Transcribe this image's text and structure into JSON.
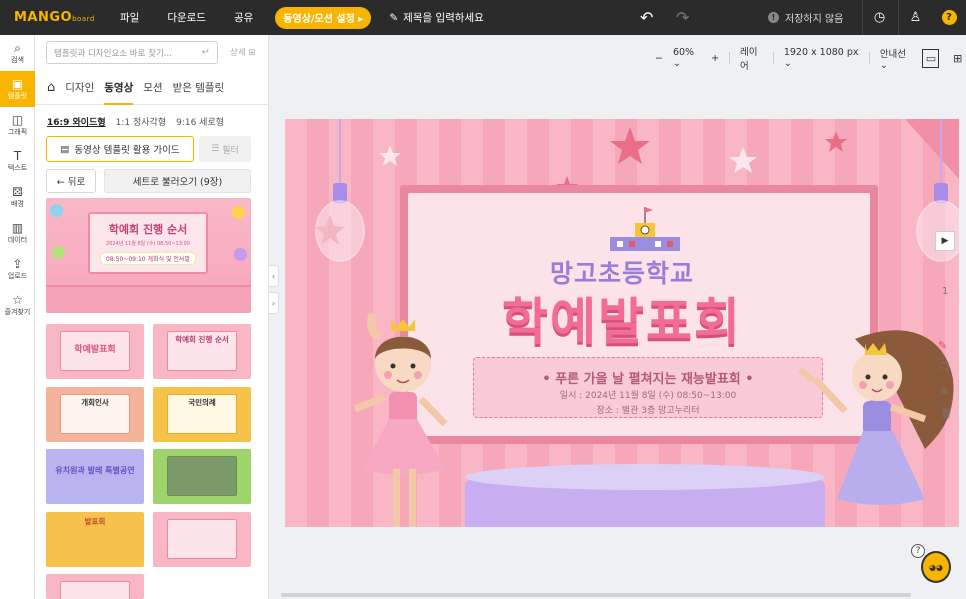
{
  "topbar": {
    "logo": "MANGO",
    "logo_sub": "board",
    "menu": [
      "파일",
      "다운로드",
      "공유"
    ],
    "mode_pill": "동영상/모션 설정 ▸",
    "title_placeholder": "제목을 입력하세요",
    "saved_status": "저장하지 않음",
    "help": "?"
  },
  "rail": [
    {
      "label": "검색",
      "icon": "⌕"
    },
    {
      "label": "템플릿",
      "icon": "▣"
    },
    {
      "label": "그래픽",
      "icon": "◫"
    },
    {
      "label": "텍스트",
      "icon": "T"
    },
    {
      "label": "배경",
      "icon": "⚄"
    },
    {
      "label": "데이터",
      "icon": "▥"
    },
    {
      "label": "업로드",
      "icon": "⇪"
    },
    {
      "label": "즐겨찾기",
      "icon": "☆"
    }
  ],
  "panel": {
    "search_placeholder": "템플릿과 디자인요소 바로 찾기...",
    "search_enter": "↵",
    "detail": "상세 ⊞",
    "tabs": [
      "디자인",
      "동영상",
      "모션",
      "받은 템플릿"
    ],
    "ratios": [
      "16:9 와이드형",
      "1:1 정사각형",
      "9:16 세로형"
    ],
    "guide_button": "동영상 템플릿 활용 가이드",
    "filter_button": "필터",
    "back_button": "← 뒤로",
    "set_button": "세트로 불러오기 (9장)",
    "big_thumb": {
      "title": "학예회 진행 순서",
      "sub": "2024년 11월 8일 (수) 08:50~13:00",
      "pill": "08:50~09:10 개회식 및 인사말"
    },
    "thumbs": [
      {
        "label": "학예발표회"
      },
      {
        "label": "학예회 진행 순서"
      },
      {
        "label": "개회인사"
      },
      {
        "label": "국민의례"
      },
      {
        "label": "유치원과 발레 특별공연"
      },
      {
        "label": ""
      },
      {
        "label": "발표회"
      },
      {
        "label": ""
      },
      {
        "label": ""
      }
    ]
  },
  "editor": {
    "zoom_minus": "−",
    "zoom": "60%",
    "zoom_plus": "+",
    "layer": "레이어",
    "size": "1920 x 1080 px",
    "guide": "안내선"
  },
  "canvas": {
    "school": "망고초등학교",
    "event": "학예발표회",
    "headline": "• 푸른 가을 날 펼쳐지는 재능발표회 •",
    "date_line": "일시 : 2024년 11월 8일 (수) 08:50~13:00",
    "place_line": "장소 : 별관 3층 망고누리터",
    "page_number": "1"
  },
  "colors": {
    "accent": "#f7b500",
    "topbar": "#2b2b2b",
    "canvas_pink": "#f9b7c6",
    "title_pink": "#f26c95",
    "school_purple": "#9a7dd6"
  }
}
